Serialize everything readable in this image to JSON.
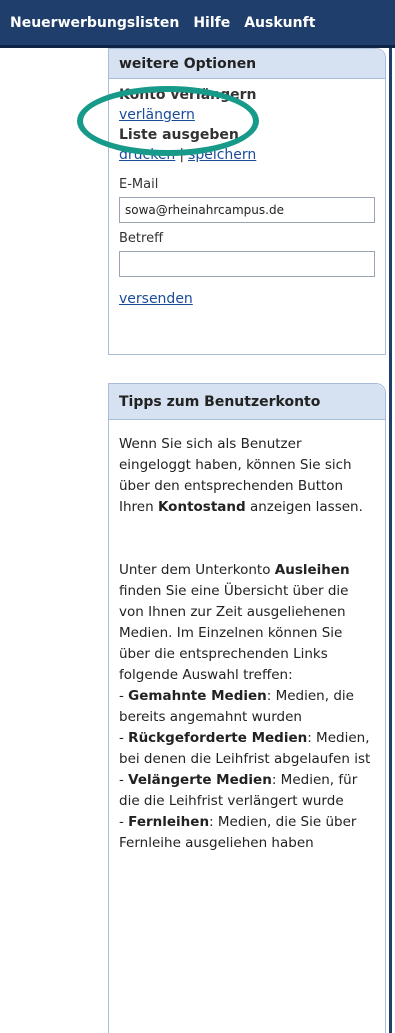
{
  "nav": {
    "items": [
      "Neuerwerbungslisten",
      "Hilfe",
      "Auskunft"
    ]
  },
  "options": {
    "title": "weitere Optionen",
    "account_title": "Konto verlängern",
    "account_link": "verlängern",
    "list_title": "Liste ausgeben",
    "print_link": "drucken",
    "separator": "|",
    "save_link": "speichern",
    "email_label": "E-Mail",
    "email_value": "sowa@rheinahrcampus.de",
    "subject_label": "Betreff",
    "subject_value": "",
    "send_link": "versenden"
  },
  "tips": {
    "title": "Tipps zum Benutzerkonto",
    "p1_before": "Wenn Sie sich als Benutzer eingeloggt haben, können Sie sich über den entsprechenden Button Ihren ",
    "p1_bold": "Kontostand",
    "p1_after": " anzeigen lassen.",
    "p2_before": "Unter dem Unterkonto ",
    "p2_bold": "Ausleihen",
    "p2_after": " finden Sie eine Übersicht über die von Ihnen zur Zeit ausgeliehenen Medien. Im Einzelnen können Sie über die entsprechenden Links folgende Auswahl treffen:",
    "items": [
      {
        "dash": "- ",
        "bold": "Gemahnte Medien",
        "text": ": Medien, die bereits angemahnt wurden"
      },
      {
        "dash": "- ",
        "bold": "Rückgeforderte Medien",
        "text": ": Medien, bei denen die Leihfrist abgelaufen ist"
      },
      {
        "dash": "- ",
        "bold": "Velängerte Medien",
        "text": ": Medien, für die die Leihfrist verlängert wurde"
      },
      {
        "dash": "- ",
        "bold": "Fernleihen",
        "text": ": Medien, die Sie über Fernleihe ausgeliehen haben"
      }
    ]
  },
  "colors": {
    "nav_bg": "#1f3e6b",
    "box_header_bg": "#d6e2f1",
    "link": "#1a4b9b",
    "highlight_ellipse": "#179a89"
  }
}
